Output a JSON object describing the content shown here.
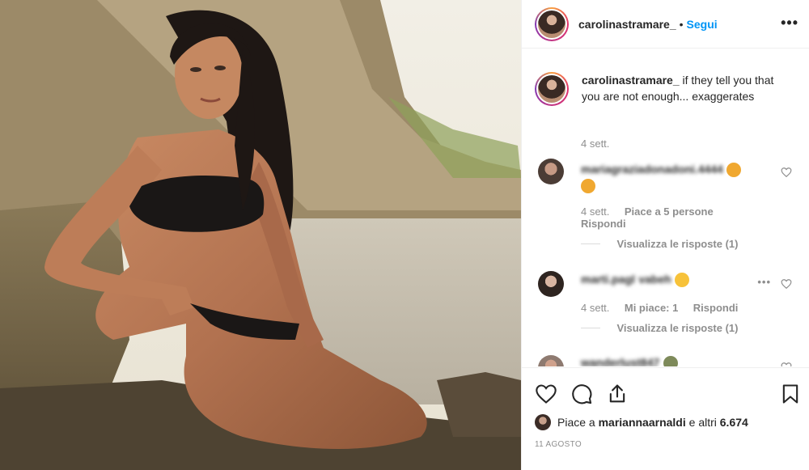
{
  "post": {
    "username": "carolinastramare_",
    "follow_label": "Segui",
    "separator": "•",
    "more_label": "•••",
    "caption_user": "carolinastramare_",
    "caption_text": "if they tell you that you are not enough... exaggerates",
    "caption_time": "4 sett."
  },
  "comments": [
    {
      "user": "mariagraziadonadoni.4444",
      "text": "",
      "time": "4 sett.",
      "likes": "Piace a 5 persone",
      "reply": "Rispondi",
      "view_replies": "Visualizza le risposte (1)"
    },
    {
      "user": "marti.pagl",
      "text": "vabeh",
      "time": "4 sett.",
      "likes": "Mi piace: 1",
      "reply": "Rispondi",
      "view_replies": "Visualizza le risposte (1)",
      "more": "•••"
    },
    {
      "user": "wanderlust847",
      "text": ""
    }
  ],
  "footer": {
    "likes_prefix": "Piace a",
    "likes_user": "mariannaarnaldi",
    "likes_suffix": "e altri",
    "likes_count": "6.674",
    "date": "11 agosto"
  },
  "colors": {
    "accent": "#0095f6",
    "muted": "#8e8e8e",
    "text": "#262626"
  },
  "icons": [
    "heart-icon",
    "comment-icon",
    "share-icon",
    "bookmark-icon",
    "more-icon"
  ]
}
